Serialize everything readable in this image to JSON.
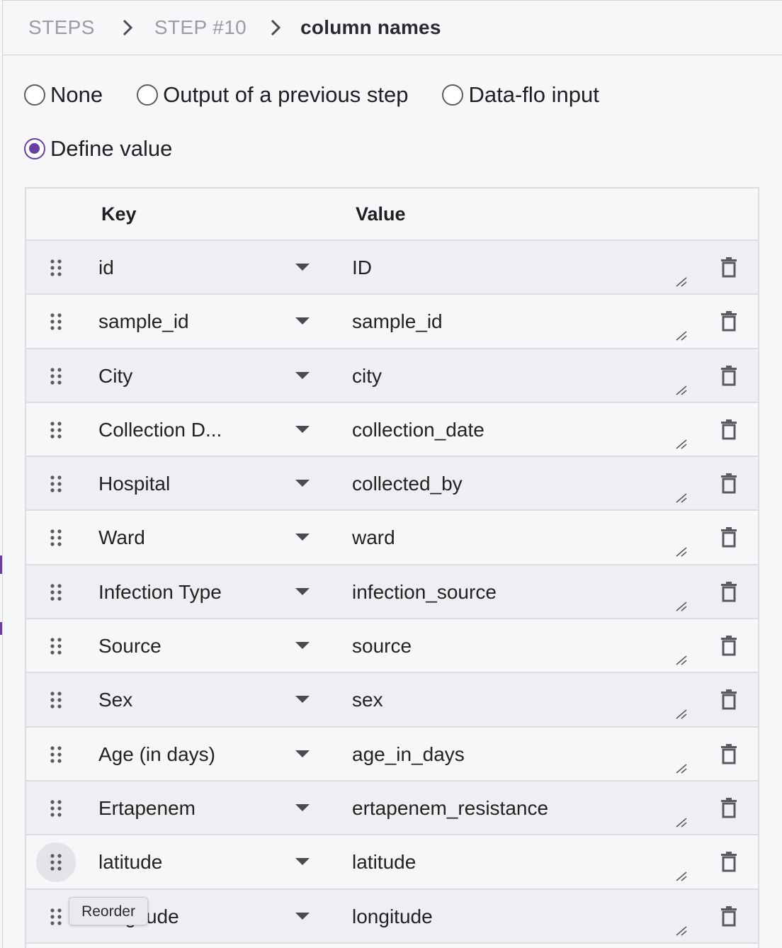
{
  "breadcrumb": {
    "steps": "STEPS",
    "step": "STEP #10",
    "current": "column names"
  },
  "radio_options": [
    {
      "label": "None",
      "checked": false
    },
    {
      "label": "Output of a previous step",
      "checked": false
    },
    {
      "label": "Data-flo input",
      "checked": false
    },
    {
      "label": "Define value",
      "checked": true
    }
  ],
  "table": {
    "key_header": "Key",
    "value_header": "Value",
    "rows": [
      {
        "key": "id",
        "value": "ID"
      },
      {
        "key": "sample_id",
        "value": "sample_id"
      },
      {
        "key": "City",
        "value": "city"
      },
      {
        "key": "Collection D...",
        "value": "collection_date"
      },
      {
        "key": "Hospital",
        "value": "collected_by"
      },
      {
        "key": "Ward",
        "value": "ward"
      },
      {
        "key": "Infection Type",
        "value": "infection_source"
      },
      {
        "key": "Source",
        "value": "source"
      },
      {
        "key": "Sex",
        "value": "sex"
      },
      {
        "key": "Age (in days)",
        "value": "age_in_days"
      },
      {
        "key": "Ertapenem",
        "value": "ertapenem_resistance"
      },
      {
        "key": "latitude",
        "value": "latitude"
      },
      {
        "key": "longitude",
        "value": "longitude"
      }
    ]
  },
  "tooltip": "Reorder",
  "icons": {
    "drag": "drag-handle-icon",
    "dropdown": "caret-down-icon",
    "resize": "textarea-resize-icon",
    "delete": "trash-icon",
    "separator": "chevron-right-icon"
  },
  "colors": {
    "accent": "#6a3fa0",
    "row_alt": "#eeeff2",
    "background": "#f6f7f9"
  }
}
